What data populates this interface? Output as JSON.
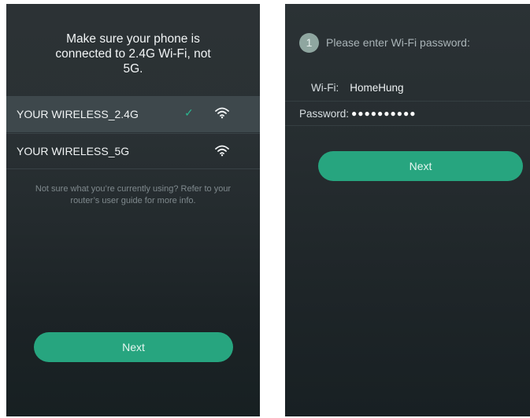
{
  "left_screen": {
    "heading": "Make sure your phone is connected to 2.4G Wi-Fi, not 5G.",
    "networks": [
      {
        "name": "YOUR WIRELESS_2.4G",
        "selected": true,
        "check": "✓"
      },
      {
        "name": "YOUR WIRELESS_5G",
        "selected": false
      }
    ],
    "help": "Not sure what you’re currently using? Refer to your router’s user guide for more info.",
    "next_label": "Next"
  },
  "right_screen": {
    "step_number": "1",
    "step_text": "Please enter Wi-Fi password:",
    "wifi_label": "Wi-Fi:",
    "wifi_value": "HomeHung",
    "password_label": "Password:",
    "password_value": "●●●●●●●●●●",
    "next_label": "Next"
  },
  "colors": {
    "accent": "#27a57f",
    "selected_row": "#3e484c",
    "check": "#2bb58f"
  },
  "icons": [
    "check-icon",
    "wifi-signal-icon"
  ]
}
